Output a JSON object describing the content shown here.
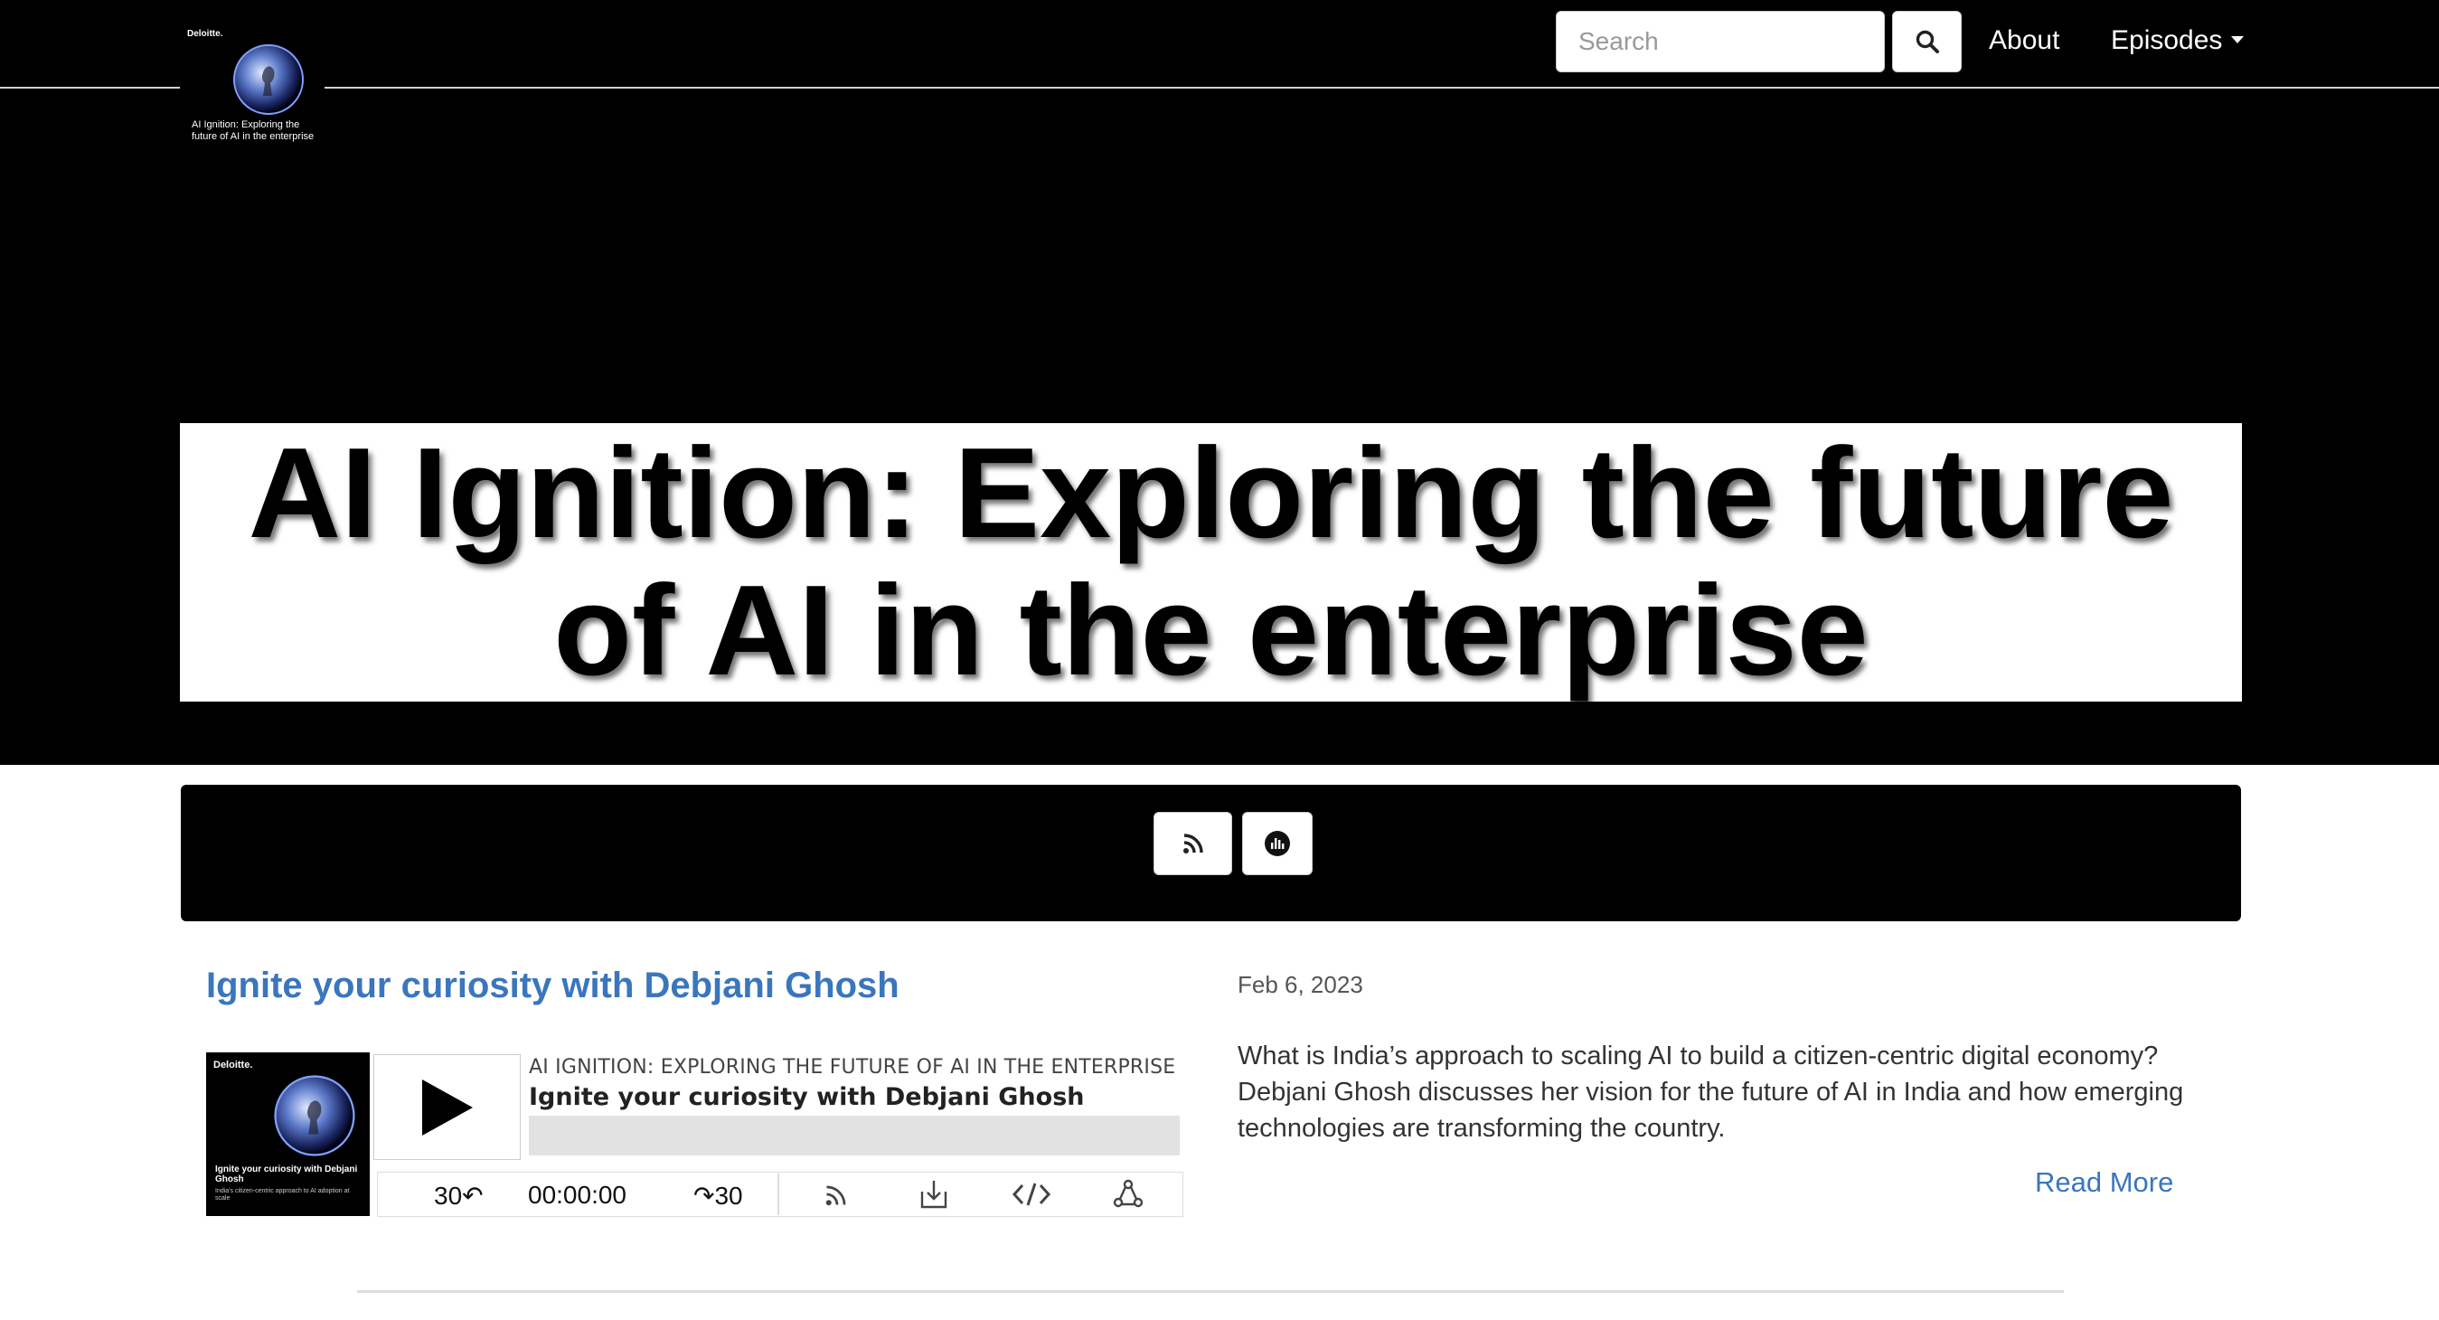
{
  "header": {
    "logo": {
      "brand": "Deloitte.",
      "caption": "AI Ignition: Exploring the future of AI in the enterprise"
    },
    "search": {
      "placeholder": "Search",
      "value": ""
    },
    "nav": {
      "about": "About",
      "episodes": "Episodes"
    }
  },
  "hero": {
    "title": "AI Ignition: Exploring the future of AI in the enterprise"
  },
  "subscribe": {
    "buttons": [
      {
        "icon": "rss-icon"
      },
      {
        "icon": "podcast-app-icon"
      }
    ]
  },
  "episode": {
    "title": "Ignite your curiosity with Debjani Ghosh",
    "date": "Feb 6, 2023",
    "description": "What is India’s approach to scaling AI to build a citizen-centric digital economy? Debjani Ghosh discusses her vision for the future of AI in India and how emerging technologies are transforming the country.",
    "read_more": "Read More",
    "player": {
      "artwork_brand": "Deloitte.",
      "artwork_caption": "Ignite your curiosity with Debjani Ghosh",
      "artwork_subcaption": "India's citizen-centric approach to AI adoption at scale",
      "show_name": "AI IGNITION: EXPLORING THE FUTURE OF AI IN THE ENTERPRISE",
      "episode_title": "Ignite your curiosity with Debjani Ghosh",
      "rewind_label": "30↶",
      "time": "00:00:00",
      "forward_label": "↷30",
      "progress": 0
    }
  },
  "colors": {
    "hero_bg": "#000000",
    "link": "#3a76bd",
    "progress_track": "#e2e2e2"
  }
}
